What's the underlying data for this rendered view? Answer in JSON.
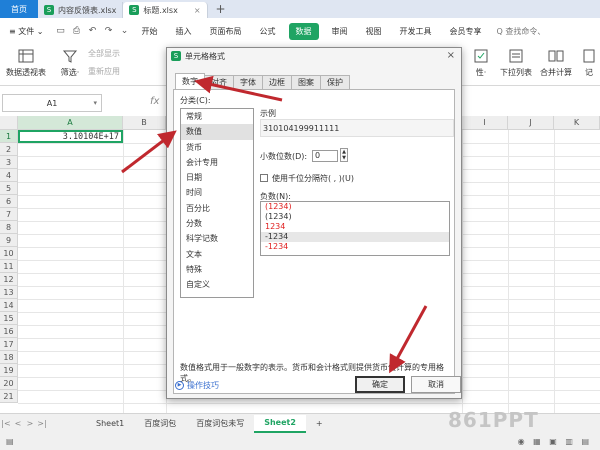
{
  "titlebar": {
    "home_label": "首页",
    "tabs": [
      {
        "label": "内容反馈表.xlsx",
        "active": false
      },
      {
        "label": "标题.xlsx",
        "active": true
      }
    ],
    "plus": "+",
    "icon_letter": "S",
    "close": "×"
  },
  "menu": {
    "file": "≡ 文件 ⌄",
    "items": [
      "开始",
      "插入",
      "页面布局",
      "公式",
      "数据",
      "审阅",
      "视图",
      "开发工具",
      "会员专享"
    ],
    "active_index": 4,
    "search": "Q 查找命令、"
  },
  "ribbon": {
    "buttons": [
      {
        "label": "数据透视表",
        "icon": "pivot-table-icon"
      },
      {
        "label": "筛选·",
        "icon": "filter-icon"
      },
      {
        "label": "性·",
        "icon": "validity-icon"
      },
      {
        "label": "下拉列表",
        "icon": "dropdown-list-icon"
      },
      {
        "label": "合并计算",
        "icon": "merge-calc-icon"
      },
      {
        "label": "记",
        "icon": "record-icon"
      }
    ],
    "small": [
      "全部显示",
      "重新应用"
    ]
  },
  "formula_bar": {
    "name_box": "A1",
    "fx": "fx"
  },
  "grid": {
    "columns": [
      "A",
      "B",
      "I",
      "J",
      "K"
    ],
    "rows": [
      "1",
      "2",
      "3",
      "4",
      "5",
      "6",
      "7",
      "8",
      "9",
      "10",
      "11",
      "12",
      "13",
      "14",
      "15",
      "16",
      "17",
      "18",
      "19",
      "20",
      "21"
    ],
    "cell_a1": "3.10104E+17"
  },
  "dialog": {
    "title": "单元格格式",
    "tabs": [
      "数字",
      "对齐",
      "字体",
      "边框",
      "图案",
      "保护"
    ],
    "category_label": "分类(C):",
    "categories": [
      "常规",
      "数值",
      "货币",
      "会计专用",
      "日期",
      "时间",
      "百分比",
      "分数",
      "科学记数",
      "文本",
      "特殊",
      "自定义"
    ],
    "selected_category": 1,
    "sample_label": "示例",
    "sample_value": "310104199911111",
    "decimal_label": "小数位数(D):",
    "decimal_value": "0",
    "thousands_label": "使用千位分隔符( , )(U)",
    "negative_label": "负数(N):",
    "negatives": [
      {
        "text": "(1234)",
        "color": "#e02020"
      },
      {
        "text": "(1234)",
        "color": "#333333"
      },
      {
        "text": "1234",
        "color": "#e02020"
      },
      {
        "text": "-1234",
        "color": "#333333"
      },
      {
        "text": "-1234",
        "color": "#e02020"
      }
    ],
    "selected_negative": 3,
    "description": "数值格式用于一般数字的表示。货币和会计格式则提供货币值计算的专用格式。",
    "help_label": "操作技巧",
    "ok_label": "确定",
    "cancel_label": "取消"
  },
  "sheets": {
    "tabs": [
      "Sheet1",
      "百度词包",
      "百度词包未写",
      "Sheet2"
    ],
    "active_index": 3,
    "add": "+"
  },
  "watermark": "861PPT",
  "colors": {
    "accent": "#1fa463",
    "home_tab": "#1f7fd7",
    "annotation_arrow": "#c0282e"
  }
}
